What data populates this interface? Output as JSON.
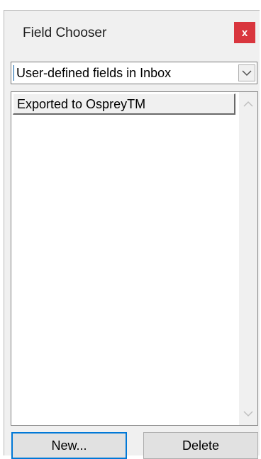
{
  "window": {
    "title": "Field Chooser",
    "close_label": "x"
  },
  "dropdown": {
    "selected": "User-defined fields in Inbox",
    "arrow_icon": "chevron-down-icon"
  },
  "fields": [
    {
      "label": "Exported to OspreyTM"
    }
  ],
  "scrollbar": {
    "up_icon": "chevron-up-icon",
    "down_icon": "chevron-down-icon"
  },
  "buttons": {
    "new_label": "New...",
    "delete_label": "Delete"
  },
  "colors": {
    "close": "#d9363e",
    "focus": "#0078d7",
    "window_bg": "#f0f0f0"
  }
}
